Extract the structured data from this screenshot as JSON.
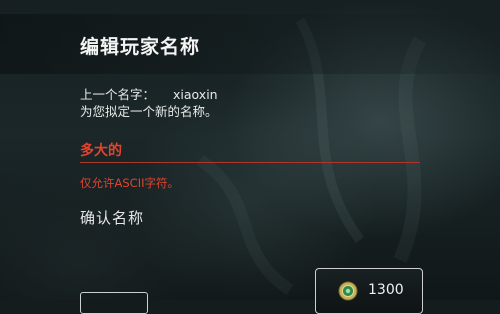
{
  "dialog": {
    "title": "编辑玩家名称",
    "previous_name_label": "上一个名字：",
    "previous_name_value": "xiaoxin",
    "prompt": "为您拟定一个新的名称。",
    "new_name_value": "多大的",
    "error_message": "仅允许ASCII字符。",
    "confirm_label": "确认名称"
  },
  "purchase": {
    "cost": "1300",
    "currency_icon": "coin-icon"
  },
  "colors": {
    "error": "#e2432e",
    "underline": "#b0352c",
    "background": "#1b2729"
  }
}
